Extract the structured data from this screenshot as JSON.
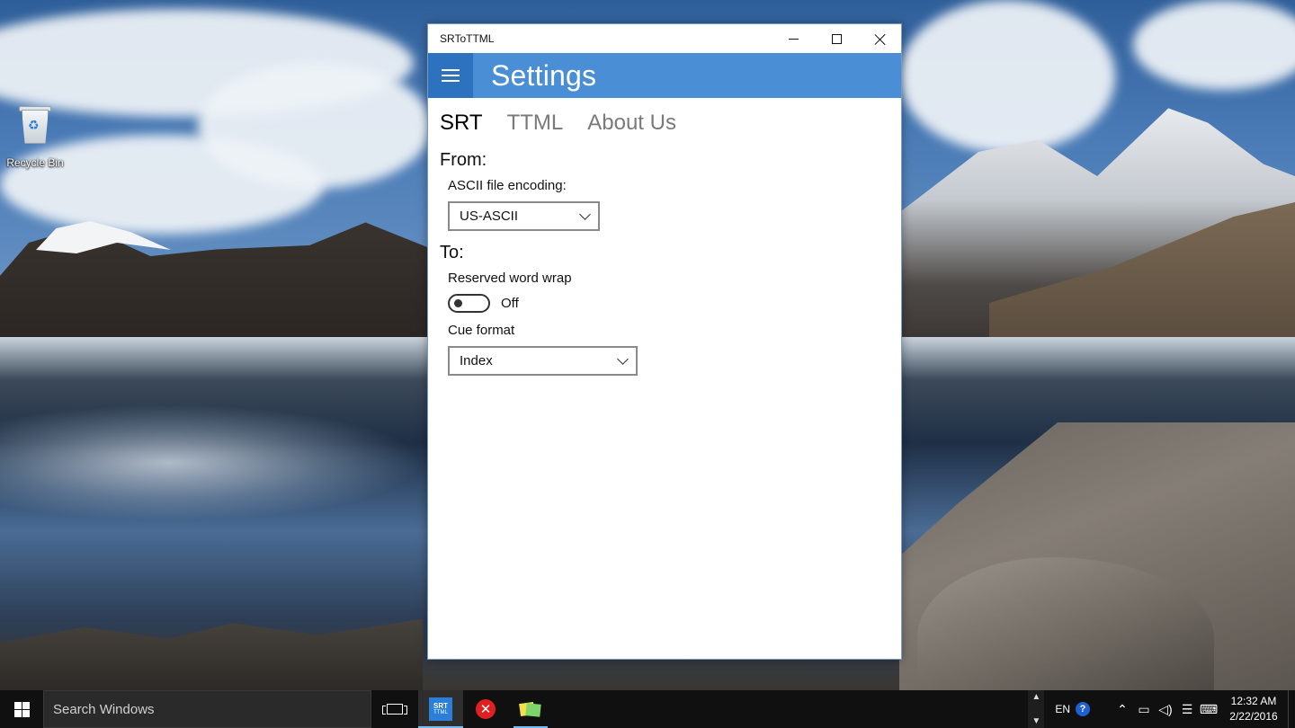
{
  "desktop": {
    "icons": [
      {
        "label": "Recycle Bin",
        "icon": "recycle-bin-icon"
      }
    ]
  },
  "window": {
    "title": "SRToTTML",
    "controls": {
      "minimize": "minimize-icon",
      "maximize": "maximize-icon",
      "close": "close-icon"
    },
    "header": {
      "menu_icon": "hamburger-icon",
      "title": "Settings",
      "accent": "#4a8ed6",
      "accent_dark": "#2c72bf"
    },
    "tabs": [
      {
        "label": "SRT",
        "active": true
      },
      {
        "label": "TTML",
        "active": false
      },
      {
        "label": "About Us",
        "active": false
      }
    ],
    "from": {
      "heading": "From:",
      "encoding_label": "ASCII file encoding:",
      "encoding_value": "US-ASCII"
    },
    "to": {
      "heading": "To:",
      "word_wrap_label": "Reserved word wrap",
      "word_wrap_state": "Off",
      "cue_format_label": "Cue format",
      "cue_format_value": "Index"
    }
  },
  "taskbar": {
    "search_placeholder": "Search Windows",
    "apps": [
      {
        "name": "SRToTTML",
        "icon_top": "SRT",
        "icon_bottom": "TTML",
        "active": true
      },
      {
        "name": "error-app",
        "icon_text": "✕"
      },
      {
        "name": "sticky-notes"
      }
    ],
    "tray": {
      "language": "EN",
      "help": "?",
      "time": "12:32 AM",
      "date": "2/22/2016"
    }
  }
}
